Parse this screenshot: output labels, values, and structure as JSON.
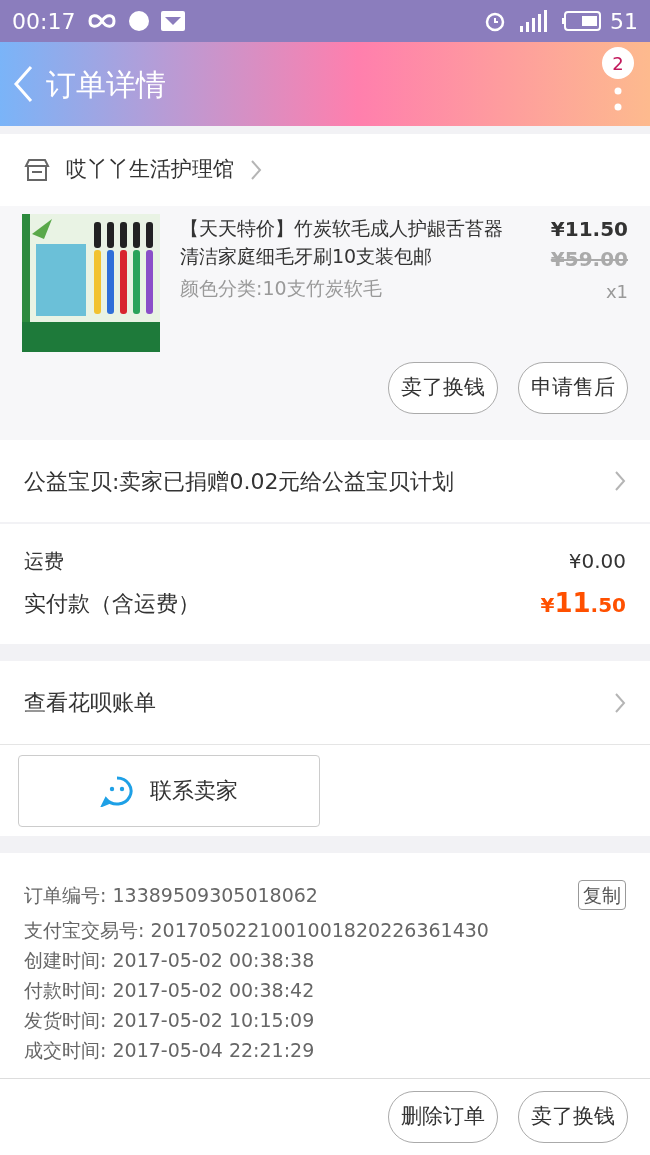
{
  "status_bar": {
    "time": "00:17",
    "battery": "51"
  },
  "header": {
    "title": "订单详情",
    "badge": "2"
  },
  "shop": {
    "name": "哎丫丫生活护理馆"
  },
  "product": {
    "title": "【天天特价】竹炭软毛成人护龈舌苔器清洁家庭细毛牙刷10支装包邮",
    "variant": "颜色分类:10支竹炭软毛",
    "price": "¥11.50",
    "original_price": "¥59.00",
    "quantity": "x1"
  },
  "product_actions": [
    "卖了换钱",
    "申请售后"
  ],
  "charity": {
    "text": "公益宝贝:卖家已捐赠0.02元给公益宝贝计划"
  },
  "fees": {
    "shipping_label": "运费",
    "shipping_value": "¥0.00",
    "paid_label": "实付款（含运费）",
    "paid_currency": "¥",
    "paid_integer": "11",
    "paid_decimal": ".50"
  },
  "huabei": {
    "text": "查看花呗账单"
  },
  "contact": {
    "label": "联系卖家"
  },
  "order_info": {
    "copy_button": "复制",
    "lines": [
      {
        "label": "订单编号:",
        "value": "13389509305018062"
      },
      {
        "label": "支付宝交易号:",
        "value": "2017050221001001820226361430"
      },
      {
        "label": "创建时间:",
        "value": "2017-05-02 00:38:38"
      },
      {
        "label": "付款时间:",
        "value": "2017-05-02 00:38:42"
      },
      {
        "label": "发货时间:",
        "value": "2017-05-02 10:15:09"
      },
      {
        "label": "成交时间:",
        "value": "2017-05-04 22:21:29"
      }
    ]
  },
  "bottom_actions": [
    "删除订单",
    "卖了换钱"
  ]
}
